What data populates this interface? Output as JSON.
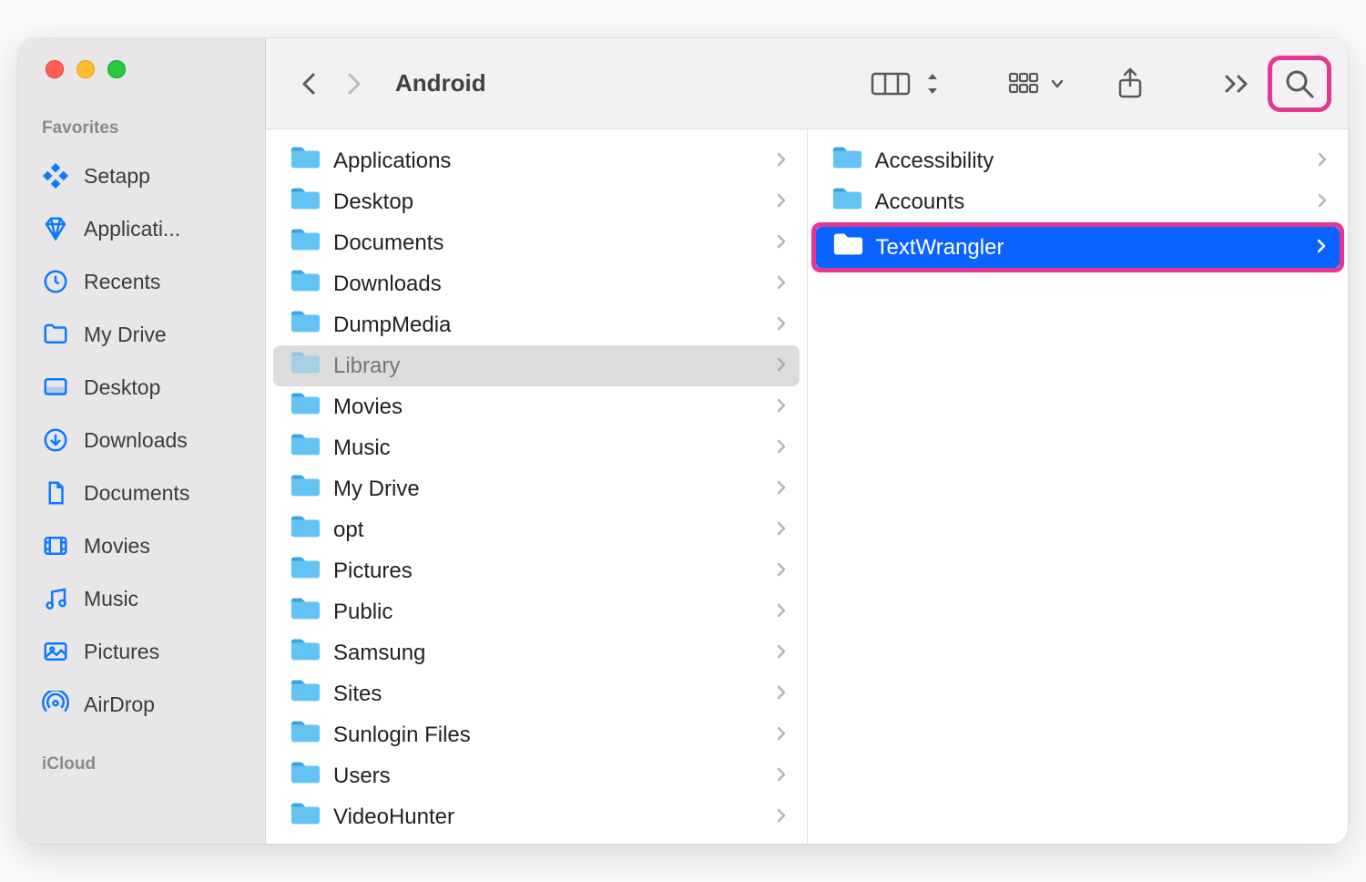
{
  "window": {
    "title": "Android"
  },
  "sidebar": {
    "sections": [
      {
        "label": "Favorites",
        "items": [
          {
            "icon": "setapp",
            "label": "Setapp"
          },
          {
            "icon": "app",
            "label": "Applicati..."
          },
          {
            "icon": "clock",
            "label": "Recents"
          },
          {
            "icon": "folder",
            "label": "My Drive"
          },
          {
            "icon": "desktop",
            "label": "Desktop"
          },
          {
            "icon": "download",
            "label": "Downloads"
          },
          {
            "icon": "document",
            "label": "Documents"
          },
          {
            "icon": "movies",
            "label": "Movies"
          },
          {
            "icon": "music",
            "label": "Music"
          },
          {
            "icon": "pictures",
            "label": "Pictures"
          },
          {
            "icon": "airdrop",
            "label": "AirDrop"
          }
        ]
      },
      {
        "label": "iCloud",
        "items": []
      }
    ]
  },
  "columns": [
    {
      "items": [
        {
          "label": "Applications"
        },
        {
          "label": "Desktop"
        },
        {
          "label": "Documents"
        },
        {
          "label": "Downloads"
        },
        {
          "label": "DumpMedia"
        },
        {
          "label": "Library",
          "expanded": true
        },
        {
          "label": "Movies"
        },
        {
          "label": "Music"
        },
        {
          "label": "My Drive"
        },
        {
          "label": "opt"
        },
        {
          "label": "Pictures"
        },
        {
          "label": "Public"
        },
        {
          "label": "Samsung"
        },
        {
          "label": "Sites"
        },
        {
          "label": "Sunlogin Files"
        },
        {
          "label": "Users"
        },
        {
          "label": "VideoHunter"
        }
      ]
    },
    {
      "items": [
        {
          "label": "Accessibility"
        },
        {
          "label": "Accounts"
        },
        {
          "label": "TextWrangler",
          "selected": true,
          "highlighted": true
        }
      ]
    }
  ]
}
